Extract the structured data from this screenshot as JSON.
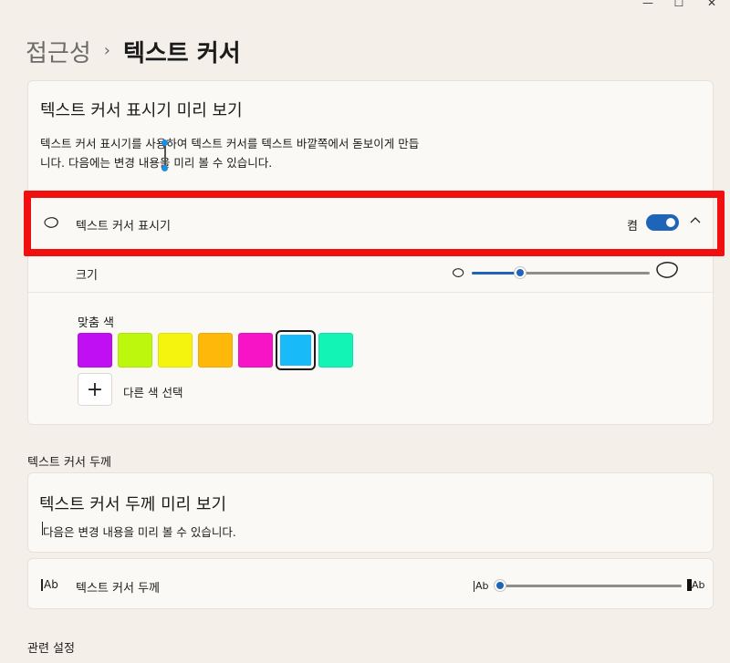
{
  "window": {
    "minimize_glyph": "—",
    "maximize_glyph": "☐",
    "close_glyph": "✕"
  },
  "breadcrumb": {
    "parent": "접근성",
    "separator": "›",
    "current": "텍스트 커서"
  },
  "preview": {
    "title": "텍스트 커서 표시기 미리 보기",
    "description": "텍스트 커서 표시기를 사용하여 텍스트 커서를 텍스트 바깥쪽에서 돋보이게 만듭니다. 다음에는 변경 내용을 미리 볼 수 있습니다."
  },
  "indicator": {
    "label": "텍스트 커서 표시기",
    "toggle_state": "켬",
    "toggle_on": true,
    "expanded": true,
    "icon": "droplet-outline-icon",
    "size": {
      "label": "크기",
      "value_fraction": 0.27
    },
    "colors": {
      "label": "맞춤 색",
      "swatches": [
        "#c00ff3",
        "#bdf70d",
        "#f5f40f",
        "#fdb80a",
        "#f714c6",
        "#18baf8",
        "#12f4b6"
      ],
      "selected_index": 5,
      "add_label": "다른 색 선택"
    }
  },
  "accent_color": "#1e64b8",
  "highlight_color": "#f20f0f",
  "thickness": {
    "section_header": "텍스트 커서 두께",
    "preview_title": "텍스트 커서 두께 미리 보기",
    "preview_desc": "다음은 변경 내용을 미리 볼 수 있습니다.",
    "label": "텍스트 커서 두께",
    "icon_text": "Ab",
    "value_fraction": 0.0
  },
  "related": {
    "section_header": "관련 설정"
  }
}
